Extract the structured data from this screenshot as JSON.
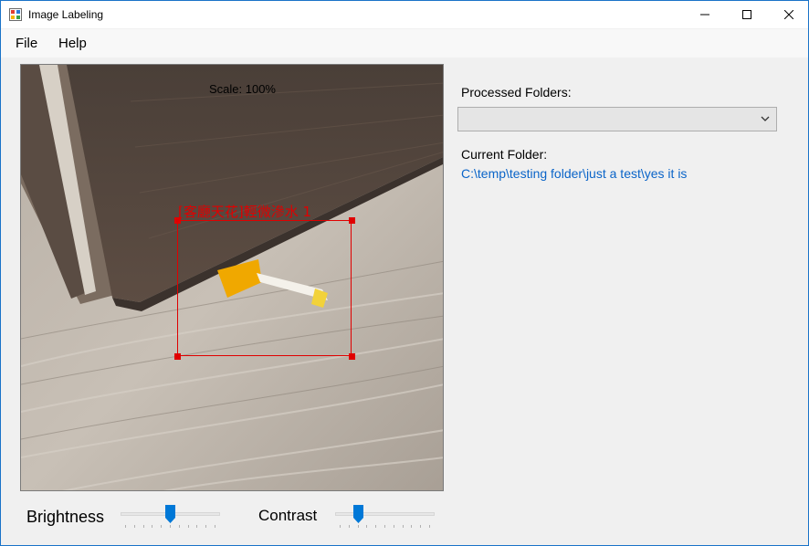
{
  "window": {
    "title": "Image Labeling",
    "minimize_icon": "minimize-icon",
    "maximize_icon": "maximize-icon",
    "close_icon": "close-icon"
  },
  "menu": {
    "items": [
      {
        "label": "File"
      },
      {
        "label": "Help"
      }
    ]
  },
  "image_view": {
    "scale_text": "Scale: 100%",
    "annotation_label": "[客廳天花]輕微滲水 1",
    "annotation_color": "#e00000"
  },
  "controls": {
    "brightness_label": "Brightness",
    "brightness_value": 0.5,
    "contrast_label": "Contrast",
    "contrast_value": 0.2
  },
  "sidebar": {
    "processed_folders_label": "Processed Folders:",
    "processed_folders_selected": "",
    "current_folder_label": "Current Folder:",
    "current_folder_path": "C:\\temp\\testing folder\\just a test\\yes it is",
    "path_color": "#0a64c8",
    "accent_color": "#0078d7"
  }
}
